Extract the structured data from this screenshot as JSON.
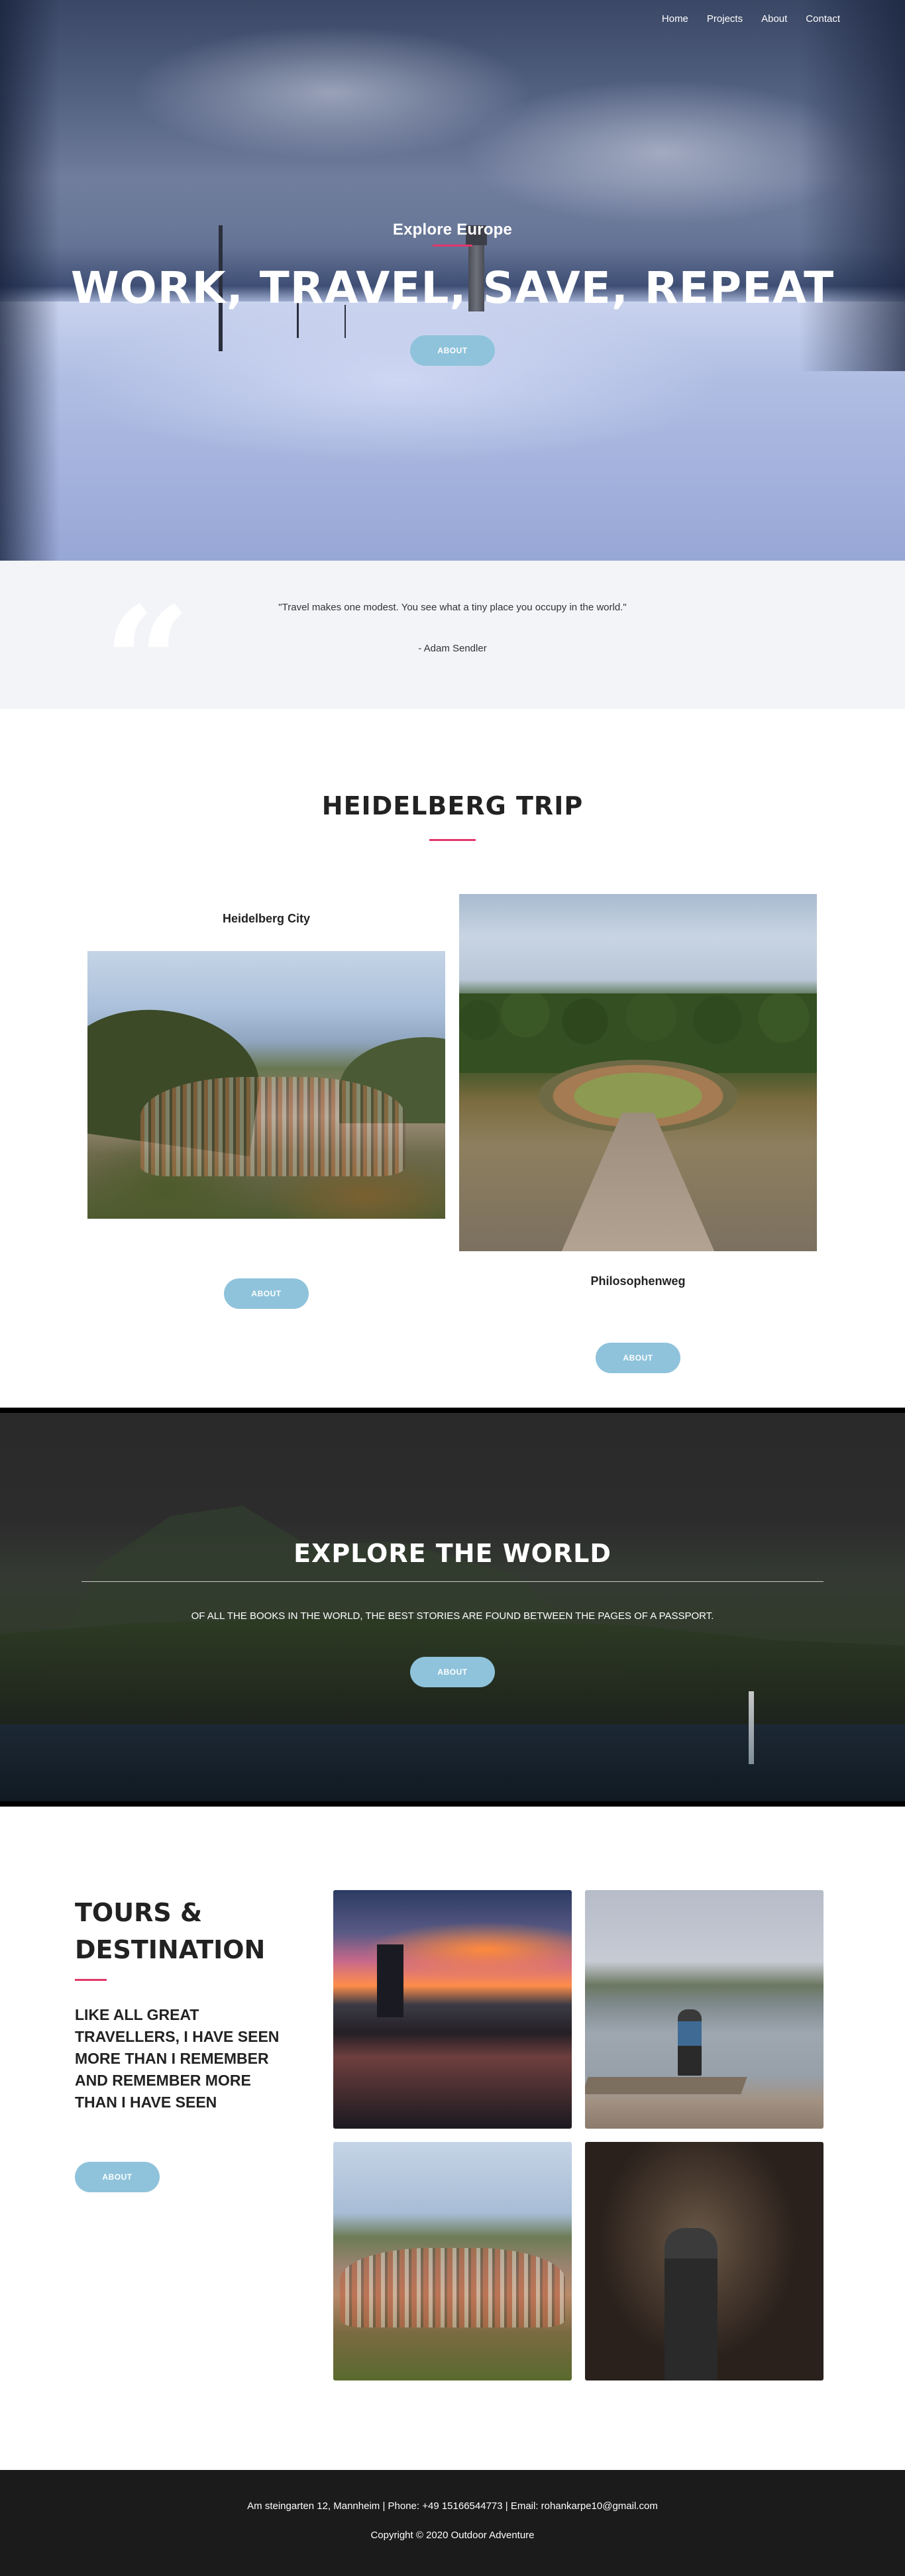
{
  "nav": {
    "items": [
      {
        "label": "Home"
      },
      {
        "label": "Projects"
      },
      {
        "label": "About"
      },
      {
        "label": "Contact"
      }
    ]
  },
  "hero": {
    "subtitle": "Explore Europe",
    "title": "WORK, TRAVEL, SAVE, REPEAT",
    "button": "ABOUT",
    "accent_color": "#e2376a"
  },
  "quote": {
    "icon": "quote-icon",
    "text": "\"Travel makes one modest. You see what a tiny place you occupy in the world.\"",
    "author": "- Adam Sendler"
  },
  "trip": {
    "title": "HEIDELBERG TRIP",
    "cards": [
      {
        "label": "Heidelberg City",
        "button": "ABOUT"
      },
      {
        "label": "Philosophenweg",
        "button": "ABOUT"
      }
    ]
  },
  "explore": {
    "title": "EXPLORE THE WORLD",
    "text": "OF ALL THE BOOKS IN THE WORLD, THE BEST STORIES ARE FOUND BETWEEN THE PAGES OF A PASSPORT.",
    "button": "ABOUT"
  },
  "tours": {
    "title": "TOURS & DESTINATION",
    "quote": "LIKE ALL GREAT TRAVELLERS, I HAVE SEEN MORE THAN I REMEMBER AND REMEMBER MORE THAN I HAVE SEEN",
    "button": "ABOUT"
  },
  "footer": {
    "contact": "Am steingarten 12, Mannheim | Phone: +49 15166544773 | Email: rohankarpe10@gmail.com",
    "copyright": "Copyright © 2020 Outdoor Adventure"
  },
  "colors": {
    "button": "#8fc3db",
    "accent": "#e2376a",
    "quote_band": "#f3f4f8",
    "footer": "#1b1b1b"
  }
}
